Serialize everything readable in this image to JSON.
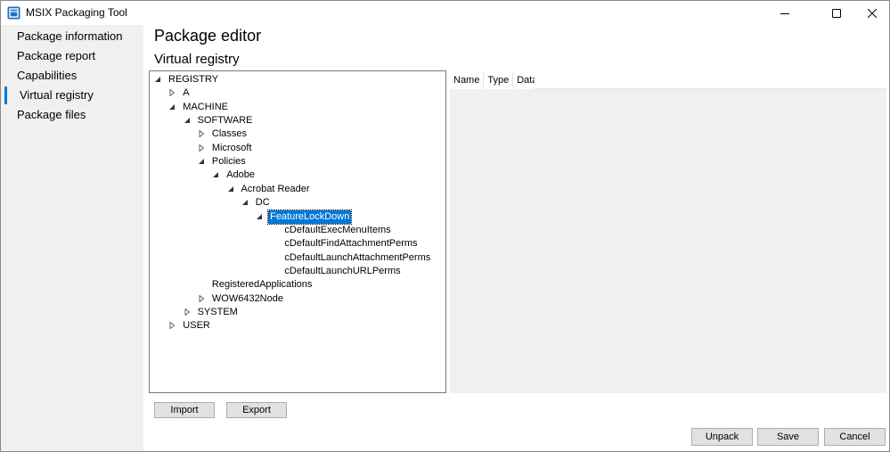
{
  "window": {
    "title": "MSIX Packaging Tool"
  },
  "sidebar": {
    "items": [
      {
        "label": "Package information"
      },
      {
        "label": "Package report"
      },
      {
        "label": "Capabilities"
      },
      {
        "label": "Virtual registry",
        "active": true
      },
      {
        "label": "Package files"
      }
    ]
  },
  "main": {
    "page_title": "Package editor",
    "section_title": "Virtual registry",
    "tree": [
      {
        "label": "REGISTRY",
        "level": 0,
        "state": "expanded"
      },
      {
        "label": "A",
        "level": 1,
        "state": "collapsed"
      },
      {
        "label": "MACHINE",
        "level": 1,
        "state": "expanded"
      },
      {
        "label": "SOFTWARE",
        "level": 2,
        "state": "expanded"
      },
      {
        "label": "Classes",
        "level": 3,
        "state": "collapsed"
      },
      {
        "label": "Microsoft",
        "level": 3,
        "state": "collapsed"
      },
      {
        "label": "Policies",
        "level": 3,
        "state": "expanded"
      },
      {
        "label": "Adobe",
        "level": 4,
        "state": "expanded"
      },
      {
        "label": "Acrobat Reader",
        "level": 5,
        "state": "expanded"
      },
      {
        "label": "DC",
        "level": 6,
        "state": "expanded"
      },
      {
        "label": "FeatureLockDown",
        "level": 7,
        "state": "expanded",
        "selected": true
      },
      {
        "label": "cDefaultExecMenuItems",
        "level": 8,
        "state": "leaf"
      },
      {
        "label": "cDefaultFindAttachmentPerms",
        "level": 8,
        "state": "leaf"
      },
      {
        "label": "cDefaultLaunchAttachmentPerms",
        "level": 8,
        "state": "leaf"
      },
      {
        "label": "cDefaultLaunchURLPerms",
        "level": 8,
        "state": "leaf"
      },
      {
        "label": "RegisteredApplications",
        "level": 3,
        "state": "leaf"
      },
      {
        "label": "WOW6432Node",
        "level": 3,
        "state": "collapsed"
      },
      {
        "label": "SYSTEM",
        "level": 2,
        "state": "collapsed"
      },
      {
        "label": "USER",
        "level": 1,
        "state": "collapsed"
      }
    ],
    "columns": [
      "Name",
      "Type",
      "Data"
    ],
    "buttons": {
      "import": "Import",
      "export": "Export",
      "unpack": "Unpack",
      "save": "Save",
      "cancel": "Cancel"
    }
  },
  "colors": {
    "accent": "#0078d7",
    "sidebar_bg": "#f0f0f0",
    "button_bg": "#e1e1e1",
    "button_border": "#adadad"
  },
  "icons": {
    "app": "msix-package-icon",
    "minimize": "minimize-icon",
    "maximize": "maximize-icon",
    "close": "close-icon",
    "expanded": "expanded-arrow-icon",
    "collapsed": "collapsed-arrow-icon"
  }
}
